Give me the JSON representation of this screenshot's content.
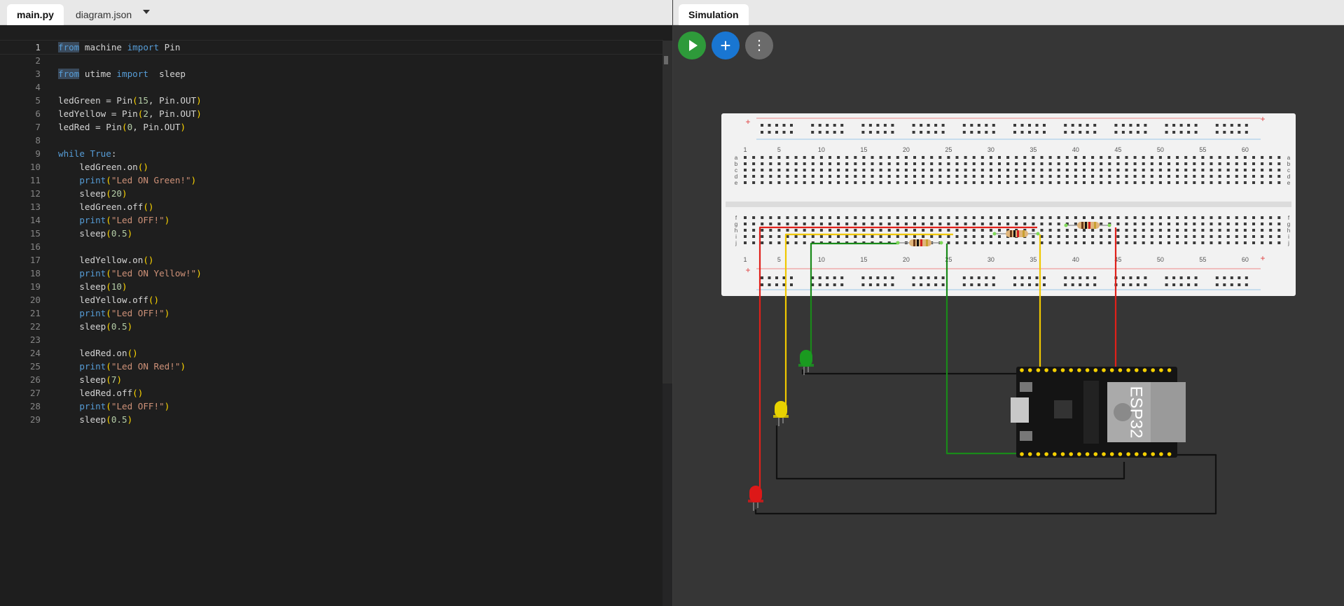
{
  "editor": {
    "tabs": [
      {
        "label": "main.py",
        "active": true
      },
      {
        "label": "diagram.json",
        "active": false
      }
    ],
    "current_line": 1,
    "code": [
      [
        {
          "t": "from",
          "c": "kw kw-hl"
        },
        {
          "t": " machine ",
          "c": ""
        },
        {
          "t": "import",
          "c": "kw"
        },
        {
          "t": " Pin",
          "c": ""
        }
      ],
      [],
      [
        {
          "t": "from",
          "c": "kw kw-hl"
        },
        {
          "t": " utime ",
          "c": ""
        },
        {
          "t": "import",
          "c": "kw"
        },
        {
          "t": "  sleep",
          "c": ""
        }
      ],
      [],
      [
        {
          "t": "ledGreen = ",
          "c": ""
        },
        {
          "t": "Pin",
          "c": ""
        },
        {
          "t": "(",
          "c": "paren"
        },
        {
          "t": "15",
          "c": "num"
        },
        {
          "t": ", Pin.OUT",
          "c": ""
        },
        {
          "t": ")",
          "c": "paren"
        }
      ],
      [
        {
          "t": "ledYellow = ",
          "c": ""
        },
        {
          "t": "Pin",
          "c": ""
        },
        {
          "t": "(",
          "c": "paren"
        },
        {
          "t": "2",
          "c": "num"
        },
        {
          "t": ", Pin.OUT",
          "c": ""
        },
        {
          "t": ")",
          "c": "paren"
        }
      ],
      [
        {
          "t": "ledRed = ",
          "c": ""
        },
        {
          "t": "Pin",
          "c": ""
        },
        {
          "t": "(",
          "c": "paren"
        },
        {
          "t": "0",
          "c": "num"
        },
        {
          "t": ", Pin.OUT",
          "c": ""
        },
        {
          "t": ")",
          "c": "paren"
        }
      ],
      [],
      [
        {
          "t": "while",
          "c": "kw"
        },
        {
          "t": " ",
          "c": ""
        },
        {
          "t": "True",
          "c": "kw"
        },
        {
          "t": ":",
          "c": ""
        }
      ],
      [
        {
          "t": "    ledGreen.on",
          "c": ""
        },
        {
          "t": "()",
          "c": "paren"
        }
      ],
      [
        {
          "t": "    ",
          "c": ""
        },
        {
          "t": "print",
          "c": "kw"
        },
        {
          "t": "(",
          "c": "paren"
        },
        {
          "t": "\"Led ON Green!\"",
          "c": "str"
        },
        {
          "t": ")",
          "c": "paren"
        }
      ],
      [
        {
          "t": "    sleep",
          "c": ""
        },
        {
          "t": "(",
          "c": "paren"
        },
        {
          "t": "20",
          "c": "num"
        },
        {
          "t": ")",
          "c": "paren"
        }
      ],
      [
        {
          "t": "    ledGreen.off",
          "c": ""
        },
        {
          "t": "()",
          "c": "paren"
        }
      ],
      [
        {
          "t": "    ",
          "c": ""
        },
        {
          "t": "print",
          "c": "kw"
        },
        {
          "t": "(",
          "c": "paren"
        },
        {
          "t": "\"Led OFF!\"",
          "c": "str"
        },
        {
          "t": ")",
          "c": "paren"
        }
      ],
      [
        {
          "t": "    sleep",
          "c": ""
        },
        {
          "t": "(",
          "c": "paren"
        },
        {
          "t": "0.5",
          "c": "num"
        },
        {
          "t": ")",
          "c": "paren"
        }
      ],
      [],
      [
        {
          "t": "    ledYellow.on",
          "c": ""
        },
        {
          "t": "()",
          "c": "paren"
        }
      ],
      [
        {
          "t": "    ",
          "c": ""
        },
        {
          "t": "print",
          "c": "kw"
        },
        {
          "t": "(",
          "c": "paren"
        },
        {
          "t": "\"Led ON Yellow!\"",
          "c": "str"
        },
        {
          "t": ")",
          "c": "paren"
        }
      ],
      [
        {
          "t": "    sleep",
          "c": ""
        },
        {
          "t": "(",
          "c": "paren"
        },
        {
          "t": "10",
          "c": "num"
        },
        {
          "t": ")",
          "c": "paren"
        }
      ],
      [
        {
          "t": "    ledYellow.off",
          "c": ""
        },
        {
          "t": "()",
          "c": "paren"
        }
      ],
      [
        {
          "t": "    ",
          "c": ""
        },
        {
          "t": "print",
          "c": "kw"
        },
        {
          "t": "(",
          "c": "paren"
        },
        {
          "t": "\"Led OFF!\"",
          "c": "str"
        },
        {
          "t": ")",
          "c": "paren"
        }
      ],
      [
        {
          "t": "    sleep",
          "c": ""
        },
        {
          "t": "(",
          "c": "paren"
        },
        {
          "t": "0.5",
          "c": "num"
        },
        {
          "t": ")",
          "c": "paren"
        }
      ],
      [],
      [
        {
          "t": "    ledRed.on",
          "c": ""
        },
        {
          "t": "()",
          "c": "paren"
        }
      ],
      [
        {
          "t": "    ",
          "c": ""
        },
        {
          "t": "print",
          "c": "kw"
        },
        {
          "t": "(",
          "c": "paren"
        },
        {
          "t": "\"Led ON Red!\"",
          "c": "str"
        },
        {
          "t": ")",
          "c": "paren"
        }
      ],
      [
        {
          "t": "    sleep",
          "c": ""
        },
        {
          "t": "(",
          "c": "paren"
        },
        {
          "t": "7",
          "c": "num"
        },
        {
          "t": ")",
          "c": "paren"
        }
      ],
      [
        {
          "t": "    ledRed.off",
          "c": ""
        },
        {
          "t": "()",
          "c": "paren"
        }
      ],
      [
        {
          "t": "    ",
          "c": ""
        },
        {
          "t": "print",
          "c": "kw"
        },
        {
          "t": "(",
          "c": "paren"
        },
        {
          "t": "\"Led OFF!\"",
          "c": "str"
        },
        {
          "t": ")",
          "c": "paren"
        }
      ],
      [
        {
          "t": "    sleep",
          "c": ""
        },
        {
          "t": "(",
          "c": "paren"
        },
        {
          "t": "0.5",
          "c": "num"
        },
        {
          "t": ")",
          "c": "paren"
        }
      ]
    ]
  },
  "simulation": {
    "tab_label": "Simulation",
    "buttons": [
      {
        "name": "run-button",
        "icon": "play-icon",
        "color": "#2e9a3a"
      },
      {
        "name": "add-part-button",
        "icon": "plus-icon",
        "glyph": "+",
        "color": "#1976d2"
      },
      {
        "name": "more-options-button",
        "icon": "more-vertical-icon",
        "glyph": "⋮",
        "color": "#6b6b6b"
      }
    ],
    "breadboard": {
      "column_labels": [
        "1",
        "5",
        "10",
        "15",
        "20",
        "25",
        "30",
        "35",
        "40",
        "45",
        "50",
        "55",
        "60"
      ],
      "row_labels_top": [
        "a",
        "b",
        "c",
        "d",
        "e"
      ],
      "row_labels_bottom": [
        "f",
        "g",
        "h",
        "i",
        "j"
      ],
      "rail_plus": "+",
      "rail_minus": "-"
    },
    "board_label": "ESP32",
    "wire_colors": {
      "red": "#e0201a",
      "yellow": "#f0c800",
      "green": "#1a8a1a",
      "black": "#111111"
    }
  }
}
